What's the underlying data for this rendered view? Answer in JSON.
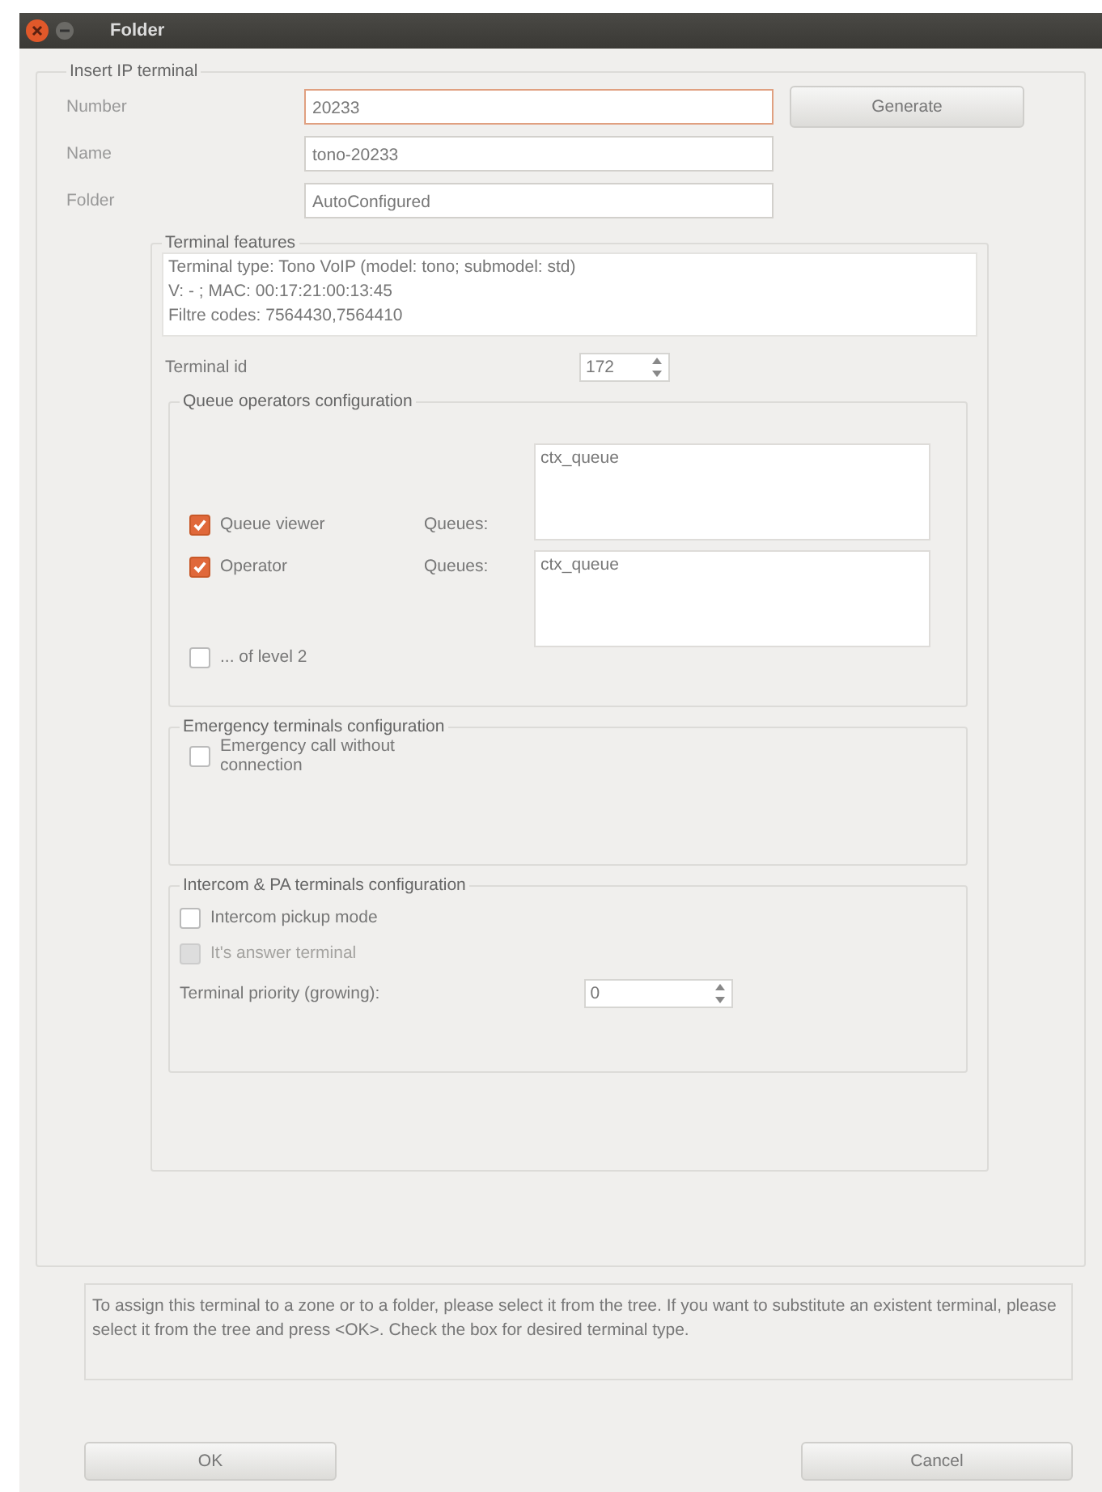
{
  "window": {
    "title": "Folder"
  },
  "insert_group": {
    "title": "Insert IP terminal"
  },
  "fields": [
    {
      "label": "Number",
      "value": "20233",
      "focused": true
    },
    {
      "label": "Name",
      "value": "tono-20233",
      "focused": false
    },
    {
      "label": "Folder",
      "value": "AutoConfigured",
      "focused": false
    }
  ],
  "generate_button": "Generate",
  "features": {
    "title": "Terminal features",
    "info_lines": [
      "Terminal type: Tono VoIP (model: tono; submodel: std)",
      "V: - ; MAC: 00:17:21:00:13:45",
      "Filtre codes: 7564430,7564410"
    ],
    "terminal_id_label": "Terminal id",
    "terminal_id": "172"
  },
  "queue_config": {
    "title": "Queue operators configuration",
    "rows": [
      {
        "label": "Queue viewer",
        "checked": true,
        "queues_label": "Queues:",
        "queues": "ctx_queue"
      },
      {
        "label": "Operator",
        "checked": true,
        "queues_label": "Queues:",
        "queues": "ctx_queue"
      }
    ],
    "level2": {
      "label": "... of level 2",
      "checked": false
    }
  },
  "emergency_config": {
    "title": "Emergency terminals configuration",
    "option": {
      "label": "Emergency call without connection",
      "checked": false
    }
  },
  "intercom_config": {
    "title": "Intercom & PA terminals configuration",
    "options": [
      {
        "label": "Intercom pickup mode",
        "checked": false,
        "disabled": false
      },
      {
        "label": "It's answer terminal",
        "checked": false,
        "disabled": true
      }
    ],
    "priority_label": "Terminal priority (growing):",
    "priority": "0"
  },
  "hint": "To assign this terminal to a zone or to a folder, please select it from the tree. If you want to substitute an existent terminal, please select it from the tree and press <OK>. Check the box for desired terminal type.",
  "buttons": [
    "OK",
    "Cancel"
  ]
}
